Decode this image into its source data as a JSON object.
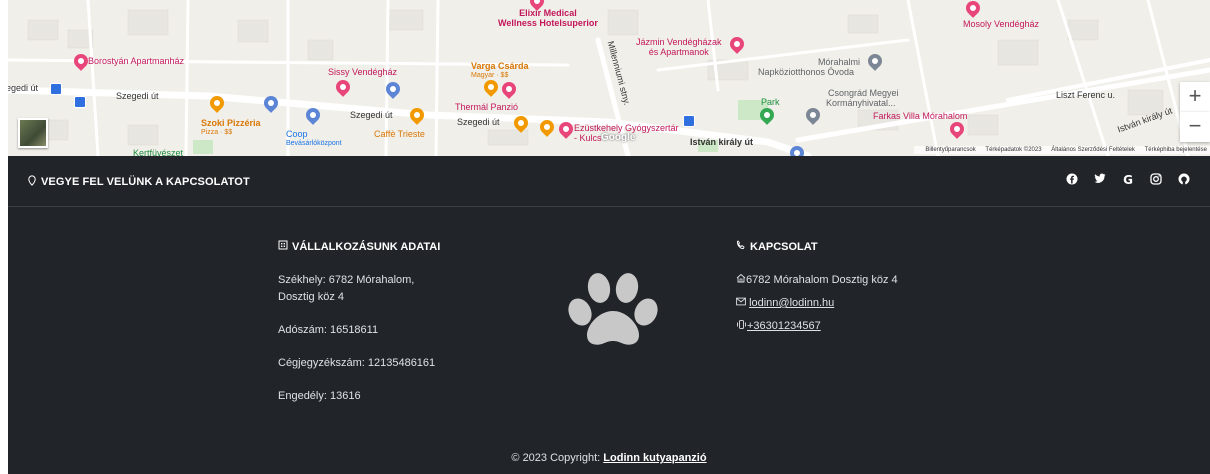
{
  "map": {
    "labels": {
      "elixir": "Elixir Medical",
      "elixir2": "Wellness Hotelsuperior",
      "jazmin": "Jázmin Vendégházak",
      "jazmin2": "és Apartmanok",
      "mosoly": "Mosoly Vendégház",
      "borostyan": "Borostyán Apartmanház",
      "sissy": "Sissy Vendégház",
      "varga": "Varga Csárda",
      "varga_sub": "Magyar · $$",
      "thermal": "Thermál Panzió",
      "szoki": "Szoki Pizzéria",
      "szoki_sub": "Pizza · $$",
      "coop": "Coop",
      "coop_sub": "Bevásárlóközpont",
      "caffe": "Caffè Trieste",
      "ezust": "Ezüstkehely Gyógyszertár",
      "ezust2": "- Kulcs",
      "morahalmi": "Mórahalmi",
      "ovoda": "Napköziotthonos Óvoda",
      "csongrad": "Csongrád Megyei",
      "kormany": "Kormányhivatal...",
      "park": "Park",
      "farkas": "Farkas Villa Mórahalom",
      "kertfuveszet": "Kertfüvészet",
      "szegedi1": "Szegedi út",
      "szegedi_left": "egedi út",
      "szegedi2": "Szegedi út",
      "szegedi3": "Szegedi út",
      "istvan": "István király út",
      "istvan2": "István király út",
      "liszt": "Liszt Ferenc u.",
      "millennium": "Millenniumi stny.",
      "google": "Google"
    },
    "zoom_in": "+",
    "zoom_out": "−",
    "attribution": [
      "Billentyűparancsok",
      "Térképadatok ©2023",
      "Általános Szerződési Feltételek",
      "Térképhiba bejelentése"
    ]
  },
  "contact_strip": {
    "icon": "map-pin-icon",
    "title": "VEGYE FEL VELÜNK A KAPCSOLATOT",
    "socials": [
      {
        "name": "facebook-icon",
        "glyph": "f"
      },
      {
        "name": "twitter-icon",
        "glyph": "🐦"
      },
      {
        "name": "google-icon",
        "glyph": "G"
      },
      {
        "name": "instagram-icon",
        "glyph": "◎"
      },
      {
        "name": "github-icon",
        "glyph": "◉"
      }
    ]
  },
  "business": {
    "heading": "VÁLLALKOZÁSUNK ADATAI",
    "seat_line1": "Székhely: 6782 Mórahalom,",
    "seat_line2": "Dosztig köz 4",
    "tax": "Adószám: 16518611",
    "company_reg": "Cégjegyzékszám: 12135486161",
    "license": "Engedély: 13616"
  },
  "contact": {
    "heading": "KAPCSOLAT",
    "address": "6782 Mórahalom Dosztig köz 4",
    "email": "lodinn@lodinn.hu",
    "phone": "+36301234567"
  },
  "footer": {
    "copyright_prefix": "© 2023 Copyright: ",
    "copyright_link": "Lodinn kutyapanzió"
  }
}
